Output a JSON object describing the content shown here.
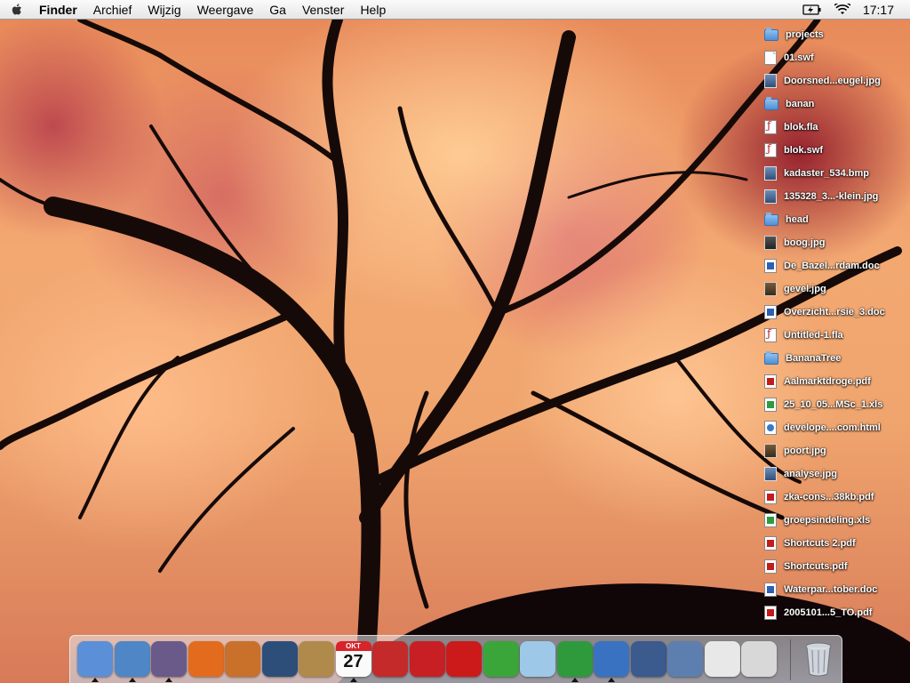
{
  "menubar": {
    "app_name": "Finder",
    "items": [
      "Archief",
      "Wijzig",
      "Weergave",
      "Ga",
      "Venster",
      "Help"
    ],
    "clock": "17:17"
  },
  "desktop": {
    "files": [
      {
        "name": "projects",
        "icon": "folder-icon",
        "kind": "folder"
      },
      {
        "name": "01.swf",
        "icon": "document-icon",
        "kind": "doc"
      },
      {
        "name": "Doorsned...eugel.jpg",
        "icon": "image-icon",
        "kind": "img"
      },
      {
        "name": "banan",
        "icon": "folder-icon",
        "kind": "folder"
      },
      {
        "name": "blok.fla",
        "icon": "flash-icon",
        "kind": "flash"
      },
      {
        "name": "blok.swf",
        "icon": "flash-icon",
        "kind": "flash"
      },
      {
        "name": "kadaster_534.bmp",
        "icon": "image-icon",
        "kind": "img"
      },
      {
        "name": "135328_3...-klein.jpg",
        "icon": "image-icon",
        "kind": "img"
      },
      {
        "name": "head",
        "icon": "folder-icon",
        "kind": "folder"
      },
      {
        "name": "boog.jpg",
        "icon": "image-icon",
        "kind": "dark"
      },
      {
        "name": "De_Bazel...rdam.doc",
        "icon": "word-document-icon",
        "kind": "word"
      },
      {
        "name": "gevel.jpg",
        "icon": "image-icon",
        "kind": "photo"
      },
      {
        "name": "Overzicht...rsie_3.doc",
        "icon": "word-document-icon",
        "kind": "word"
      },
      {
        "name": "Untitled-1.fla",
        "icon": "flash-icon",
        "kind": "flash"
      },
      {
        "name": "BananaTree",
        "icon": "folder-icon",
        "kind": "folder"
      },
      {
        "name": "Aalmarktdroge.pdf",
        "icon": "pdf-icon",
        "kind": "pdf"
      },
      {
        "name": "25_10_05...MSc_1.xls",
        "icon": "excel-icon",
        "kind": "excel"
      },
      {
        "name": "develope....com.html",
        "icon": "html-icon",
        "kind": "html"
      },
      {
        "name": "poort.jpg",
        "icon": "image-icon",
        "kind": "photo"
      },
      {
        "name": "analyse.jpg",
        "icon": "image-icon",
        "kind": "img"
      },
      {
        "name": "zka-cons...38kb.pdf",
        "icon": "pdf-icon",
        "kind": "pdf"
      },
      {
        "name": "groepsindeling.xls",
        "icon": "excel-icon",
        "kind": "excel"
      },
      {
        "name": "Shortcuts 2.pdf",
        "icon": "pdf-icon",
        "kind": "pdf"
      },
      {
        "name": "Shortcuts.pdf",
        "icon": "pdf-icon",
        "kind": "pdf"
      },
      {
        "name": "Waterpar...tober.doc",
        "icon": "word-document-icon",
        "kind": "word"
      },
      {
        "name": "2005101...5_TO.pdf",
        "icon": "pdf-icon",
        "kind": "pdf"
      }
    ]
  },
  "dock": {
    "apps": [
      {
        "name": "finder-icon",
        "color": "#5b8fd8",
        "running": true
      },
      {
        "name": "safari-icon",
        "color": "#4f86c6",
        "running": true
      },
      {
        "name": "camino-icon",
        "color": "#6a5a8a",
        "running": true
      },
      {
        "name": "firefox-icon",
        "color": "#e36b1e",
        "running": false
      },
      {
        "name": "painter-icon",
        "color": "#c9702a",
        "running": false
      },
      {
        "name": "iphoto-icon",
        "color": "#2e4e7a",
        "running": false
      },
      {
        "name": "address-book-icon",
        "color": "#b08a4a",
        "running": false
      },
      {
        "name": "ical-icon",
        "color": "#ffffff",
        "running": true,
        "date": "27",
        "month": "OKT"
      },
      {
        "name": "no-entry-icon",
        "color": "#c42a2a",
        "running": false
      },
      {
        "name": "acrobat-icon",
        "color": "#c81f24",
        "running": false
      },
      {
        "name": "flash-icon",
        "color": "#cc1a1a",
        "running": false
      },
      {
        "name": "dreamweaver-icon",
        "color": "#3aa63a",
        "running": false
      },
      {
        "name": "itunes-icon",
        "color": "#9ec8e8",
        "running": false
      },
      {
        "name": "excel-icon",
        "color": "#2e9a3c",
        "running": true
      },
      {
        "name": "word-icon",
        "color": "#3a72c2",
        "running": true
      },
      {
        "name": "keynote-icon",
        "color": "#3b5a8e",
        "running": false
      },
      {
        "name": "mail-icon",
        "color": "#5d7fb0",
        "running": false
      },
      {
        "name": "preview-icon",
        "color": "#e8e8e8",
        "running": false
      },
      {
        "name": "apple-system-icon",
        "color": "#d8d8d8",
        "running": false
      }
    ],
    "trash": "trash-icon"
  }
}
